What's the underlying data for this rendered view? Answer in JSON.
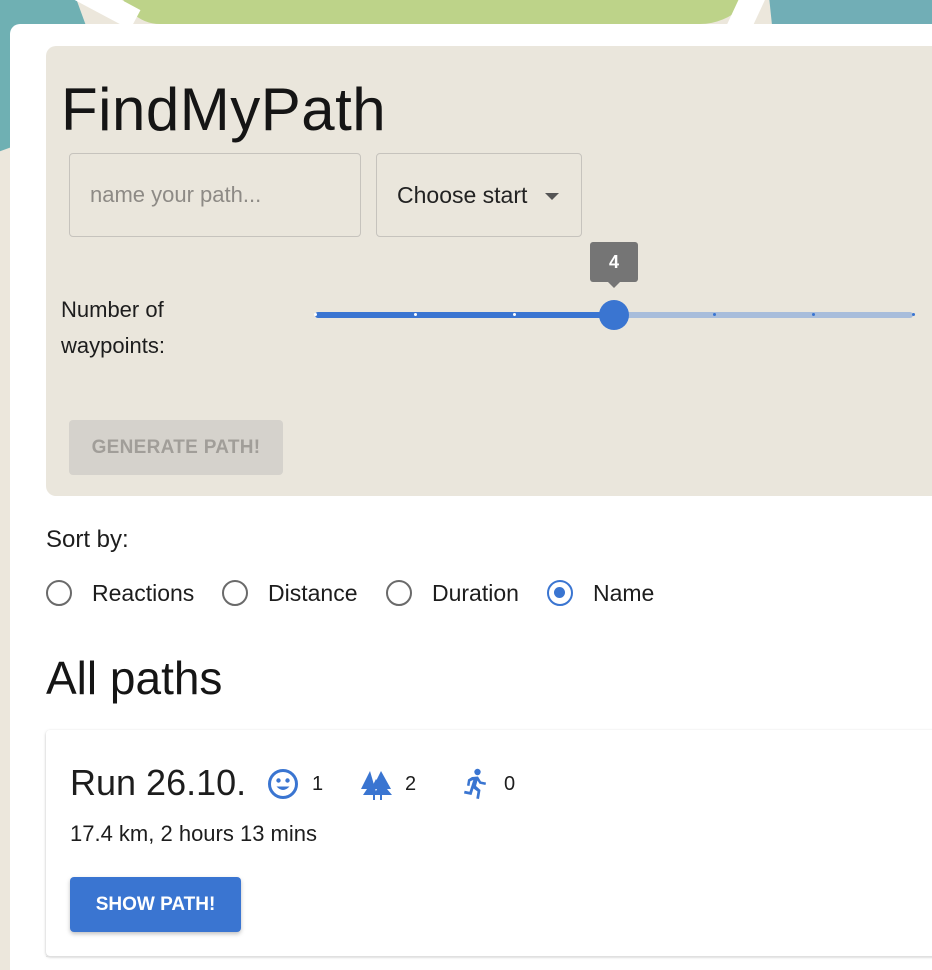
{
  "app": {
    "title": "FindMyPath"
  },
  "form": {
    "name_placeholder": "name your path...",
    "name_value": "",
    "start_select": {
      "selected_label": "Choose start"
    },
    "waypoints": {
      "label": "Number of waypoints:",
      "value": "4",
      "min": 1,
      "max": 7
    },
    "generate_label": "GENERATE PATH!"
  },
  "sort": {
    "label": "Sort by:",
    "options": [
      {
        "label": "Reactions",
        "checked": false
      },
      {
        "label": "Distance",
        "checked": false
      },
      {
        "label": "Duration",
        "checked": false
      },
      {
        "label": "Name",
        "checked": true
      }
    ]
  },
  "paths": {
    "heading": "All paths",
    "items": [
      {
        "name": "Run 26.10.",
        "reactions": [
          {
            "icon": "smiley-icon",
            "count": "1"
          },
          {
            "icon": "trees-icon",
            "count": "2"
          },
          {
            "icon": "runner-icon",
            "count": "0"
          }
        ],
        "meta": "17.4 km, 2 hours 13 mins",
        "show_label": "SHOW PATH!"
      }
    ]
  },
  "colors": {
    "accent": "#3a75d1",
    "panel": "#eae6dc",
    "disabled_button": "#d5d2cc"
  }
}
